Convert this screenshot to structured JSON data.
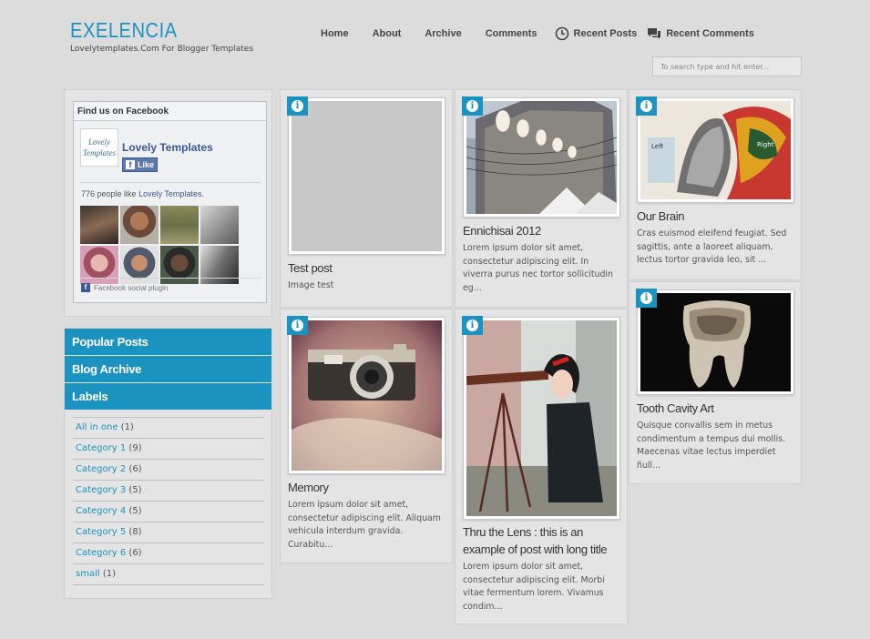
{
  "site": {
    "title": "EXELENCIA",
    "tagline": "Lovelytemplates.Com For Blogger Templates"
  },
  "nav": {
    "items": [
      "Home",
      "About",
      "Archive",
      "Comments",
      "Recent Posts",
      "Recent Comments"
    ]
  },
  "search": {
    "placeholder": "To search type and hit enter..."
  },
  "facebook": {
    "header": "Find us on Facebook",
    "logo_text": "Lovely Templates",
    "page_name": "Lovely Templates",
    "like_label": "Like",
    "like_icon": "f",
    "count_prefix": "776 people like",
    "count_link": "Lovely Templates.",
    "plugin_icon": "f",
    "plugin_text": "Facebook social plugin"
  },
  "sidebar": {
    "widgets": [
      "Popular Posts",
      "Blog Archive",
      "Labels"
    ],
    "labels": [
      {
        "name": "All in one",
        "count": "(1)"
      },
      {
        "name": "Category 1",
        "count": "(9)"
      },
      {
        "name": "Category 2",
        "count": "(6)"
      },
      {
        "name": "Category 3",
        "count": "(5)"
      },
      {
        "name": "Category 4",
        "count": "(5)"
      },
      {
        "name": "Category 5",
        "count": "(8)"
      },
      {
        "name": "Category 6",
        "count": "(6)"
      },
      {
        "name": "small",
        "count": "(1)"
      }
    ]
  },
  "posts": [
    {
      "title": "Test post",
      "excerpt": "Image test"
    },
    {
      "title": "Ennichisai 2012",
      "excerpt": "Lorem ipsum dolor sit amet, consectetur adipiscing elit. In viverra purus nec tortor sollicitudin eg..."
    },
    {
      "title": "Our Brain",
      "excerpt": "Cras euismod eleifend feugiat. Sed sagittis, ante a laoreet aliquam, lectus tortor gravida leo, sit ..."
    },
    {
      "title": "Memory",
      "excerpt": "Lorem ipsum dolor sit amet, consectetur adipiscing elit. Aliquam vehicula interdum gravida. Curabitu..."
    },
    {
      "title": "Thru the Lens : this is an example of post with long title",
      "excerpt": "Lorem ipsum dolor sit amet, consectetur adipiscing elit. Morbi vitae fermentum lorem. Vivamus condim..."
    },
    {
      "title": "Tooth Cavity Art",
      "excerpt": "Quisque convallis sem in metus condimentum a tempus dui mollis. Maecenas vitae lectus imperdiet ñull..."
    }
  ],
  "info_icon": "i",
  "colors": {
    "accent": "#1a93c0",
    "background": "#dcdcdc",
    "card": "#e4e4e4",
    "facebook": "#3b5998"
  }
}
